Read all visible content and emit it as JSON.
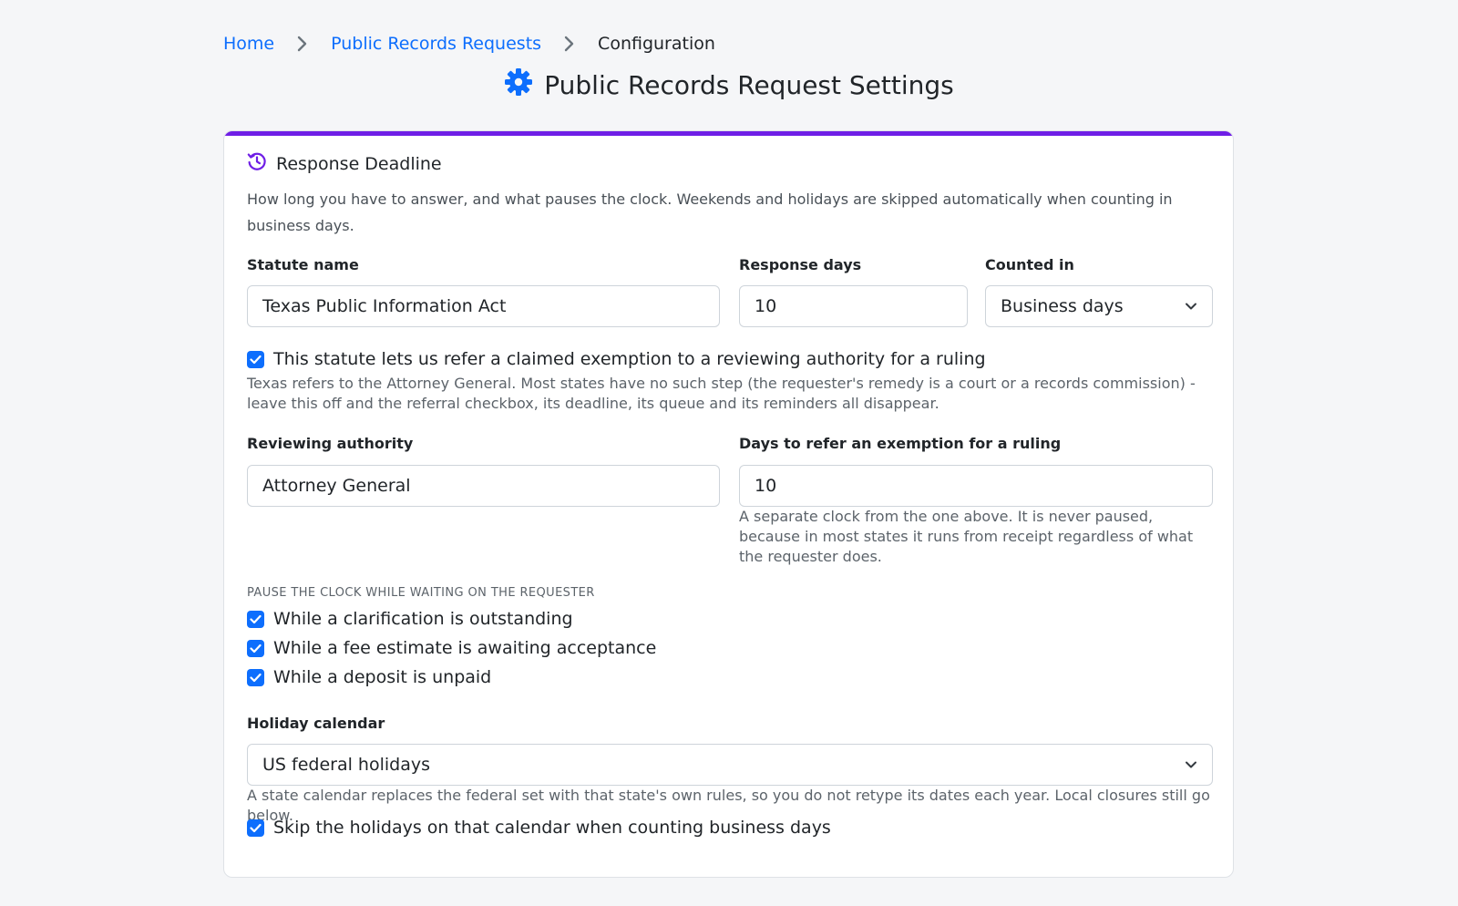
{
  "breadcrumb": {
    "home": "Home",
    "section": "Public Records Requests",
    "current": "Configuration"
  },
  "page": {
    "title": "Public Records Request Settings",
    "title_icon": "gear-icon"
  },
  "card": {
    "title": "Response Deadline",
    "title_icon": "history-clock-icon",
    "accent_color": "#6f1ee6",
    "description": "How long you have to answer, and what pauses the clock. Weekends and holidays are skipped automatically when counting in business days."
  },
  "fields": {
    "statute_name": {
      "label": "Statute name",
      "value": "Texas Public Information Act"
    },
    "response_days": {
      "label": "Response days",
      "value": "10"
    },
    "counted_in": {
      "label": "Counted in",
      "value": "Business days"
    },
    "referral_checkbox": {
      "label": "This statute lets us refer a claimed exemption to a reviewing authority for a ruling",
      "checked": true,
      "help": "Texas refers to the Attorney General. Most states have no such step (the requester's remedy is a court or a records commission) - leave this off and the referral checkbox, its deadline, its queue and its reminders all disappear."
    },
    "reviewing_authority": {
      "label": "Reviewing authority",
      "value": "Attorney General"
    },
    "referral_days": {
      "label": "Days to refer an exemption for a ruling",
      "value": "10",
      "help": "A separate clock from the one above. It is never paused, because in most states it runs from receipt regardless of what the requester does."
    },
    "pause_section": {
      "caption": "PAUSE THE CLOCK WHILE WAITING ON THE REQUESTER",
      "options": [
        {
          "label": "While a clarification is outstanding",
          "checked": true
        },
        {
          "label": "While a fee estimate is awaiting acceptance",
          "checked": true
        },
        {
          "label": "While a deposit is unpaid",
          "checked": true
        }
      ]
    },
    "holiday_calendar": {
      "label": "Holiday calendar",
      "value": "US federal holidays",
      "help": "A state calendar replaces the federal set with that state's own rules, so you do not retype its dates each year. Local closures still go below."
    },
    "skip_holidays": {
      "label": "Skip the holidays on that calendar when counting business days",
      "checked": true
    }
  },
  "colors": {
    "link": "#0d6efd",
    "checkbox": "#0d6efd",
    "accent": "#6f1ee6"
  }
}
